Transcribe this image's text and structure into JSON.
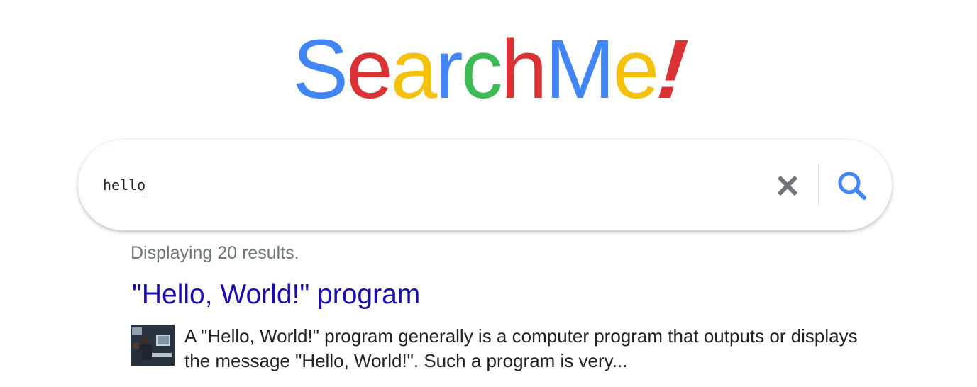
{
  "logo": {
    "letters": [
      {
        "char": "S",
        "color": "#4285f4"
      },
      {
        "char": "e",
        "color": "#db3236"
      },
      {
        "char": "a",
        "color": "#f4c20d"
      },
      {
        "char": "r",
        "color": "#4285f4"
      },
      {
        "char": "c",
        "color": "#3cba54"
      },
      {
        "char": "h",
        "color": "#db3236"
      },
      {
        "char": "M",
        "color": "#4285f4"
      },
      {
        "char": "e",
        "color": "#f4c20d"
      },
      {
        "char": "!",
        "color": "#db3236"
      }
    ]
  },
  "search": {
    "value": "hello",
    "clear_icon": "close-icon",
    "search_icon": "search-icon",
    "search_icon_color": "#4285f4",
    "clear_icon_color": "#70757a"
  },
  "results": {
    "count_text": "Displaying 20 results.",
    "items": [
      {
        "title": "\"Hello, World!\" program",
        "snippet": "A \"Hello, World!\" program generally is a computer program that outputs or displays the message \"Hello, World!\". Such a program is very..."
      }
    ]
  }
}
